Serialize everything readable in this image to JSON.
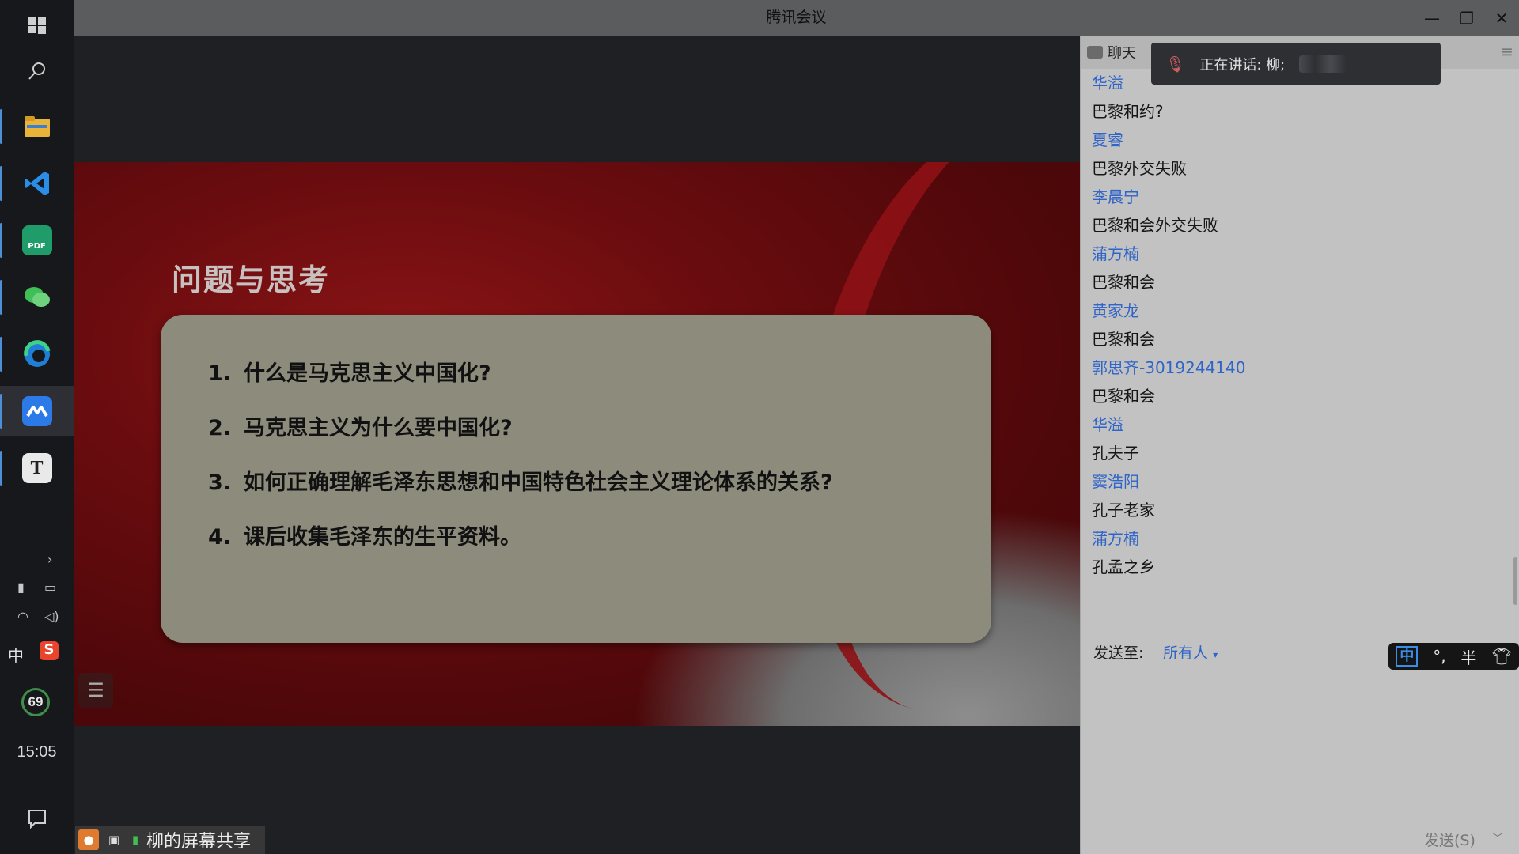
{
  "window": {
    "title": "腾讯会议"
  },
  "taskbar": {
    "apps": [
      "file-explorer",
      "vscode",
      "pdf-editor",
      "wechat",
      "edge",
      "tencent-meeting",
      "typora"
    ],
    "ime_indicator": "中",
    "battery_percent": "69",
    "clock": "15:05"
  },
  "slide": {
    "heading": "问题与思考",
    "questions": [
      {
        "num": "1.",
        "text": "什么是马克思主义中国化?"
      },
      {
        "num": "2.",
        "text": "马克思主义为什么要中国化?"
      },
      {
        "num": "3.",
        "text": "如何正确理解毛泽东思想和中国特色社会主义理论体系的关系?"
      },
      {
        "num": "4.",
        "text": "课后收集毛泽东的生平资料。"
      }
    ]
  },
  "share": {
    "label": "柳的屏幕共享"
  },
  "chat": {
    "tab_label": "聊天",
    "speaking_label": "正在讲话: 柳;",
    "messages": [
      {
        "sender": "华溢",
        "text": "巴黎和约?"
      },
      {
        "sender": "夏睿",
        "text": "巴黎外交失败"
      },
      {
        "sender": "李晨宁",
        "text": "巴黎和会外交失败"
      },
      {
        "sender": "蒲方楠",
        "text": "巴黎和会"
      },
      {
        "sender": "黄家龙",
        "text": "巴黎和会"
      },
      {
        "sender": "郭思齐-3019244140",
        "text": "巴黎和会"
      },
      {
        "sender": "华溢",
        "text": "孔夫子"
      },
      {
        "sender": "窦浩阳",
        "text": "孔子老家"
      },
      {
        "sender": "蒲方楠",
        "text": "孔孟之乡"
      }
    ],
    "send_to_label": "发送至:",
    "send_to_value": "所有人",
    "send_button": "发送(S)"
  },
  "ime": {
    "mode": "中",
    "punct": "°,",
    "width": "半"
  },
  "colors": {
    "sender": "#2f64c8",
    "slide_red": "#6a0c0f",
    "card": "#8d8b7c"
  }
}
